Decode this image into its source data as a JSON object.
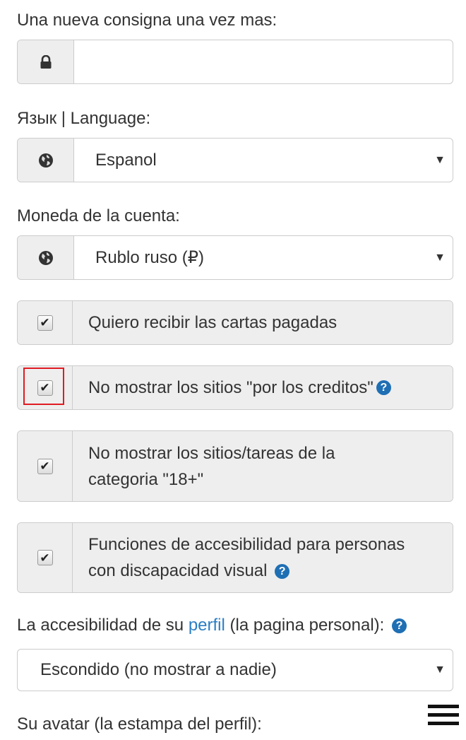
{
  "password_confirm": {
    "label": "Una nueva consigna una vez mas:",
    "icon": "lock-icon",
    "value": ""
  },
  "language": {
    "label": "Язык | Language:",
    "icon": "globe-icon",
    "selected": "Espanol"
  },
  "currency": {
    "label": "Moneda de la cuenta:",
    "icon": "globe-icon",
    "selected": "Rublo ruso (₽)"
  },
  "options": {
    "paid_letters": {
      "label": "Quiero recibir las cartas pagadas",
      "checked": true
    },
    "hide_credit_sites": {
      "label": "No mostrar los sitios \"por los creditos\"",
      "checked": true,
      "help": "?"
    },
    "hide_adult": {
      "label_line1": "No mostrar los sitios/tareas de la",
      "label_line2": "categoria \"18+\"",
      "checked": true
    },
    "accessibility": {
      "label_line1": "Funciones de accesibilidad para personas",
      "label_line2": "con discapacidad visual",
      "checked": true,
      "help": "?"
    }
  },
  "profile_visibility": {
    "label_before": "La accesibilidad de su ",
    "label_link": "perfil",
    "label_after": " (la pagina personal):",
    "help": "?",
    "selected": "Escondido (no mostrar a nadie)"
  },
  "avatar": {
    "label": "Su avatar (la estampa del perfil):"
  },
  "menu_icon": "hamburger-menu-icon",
  "colors": {
    "link": "#2a7fc4",
    "help_icon": "#1f6fb4",
    "highlight": "#e01b22",
    "addon_bg": "#eeeeee",
    "border": "#cccccc"
  }
}
